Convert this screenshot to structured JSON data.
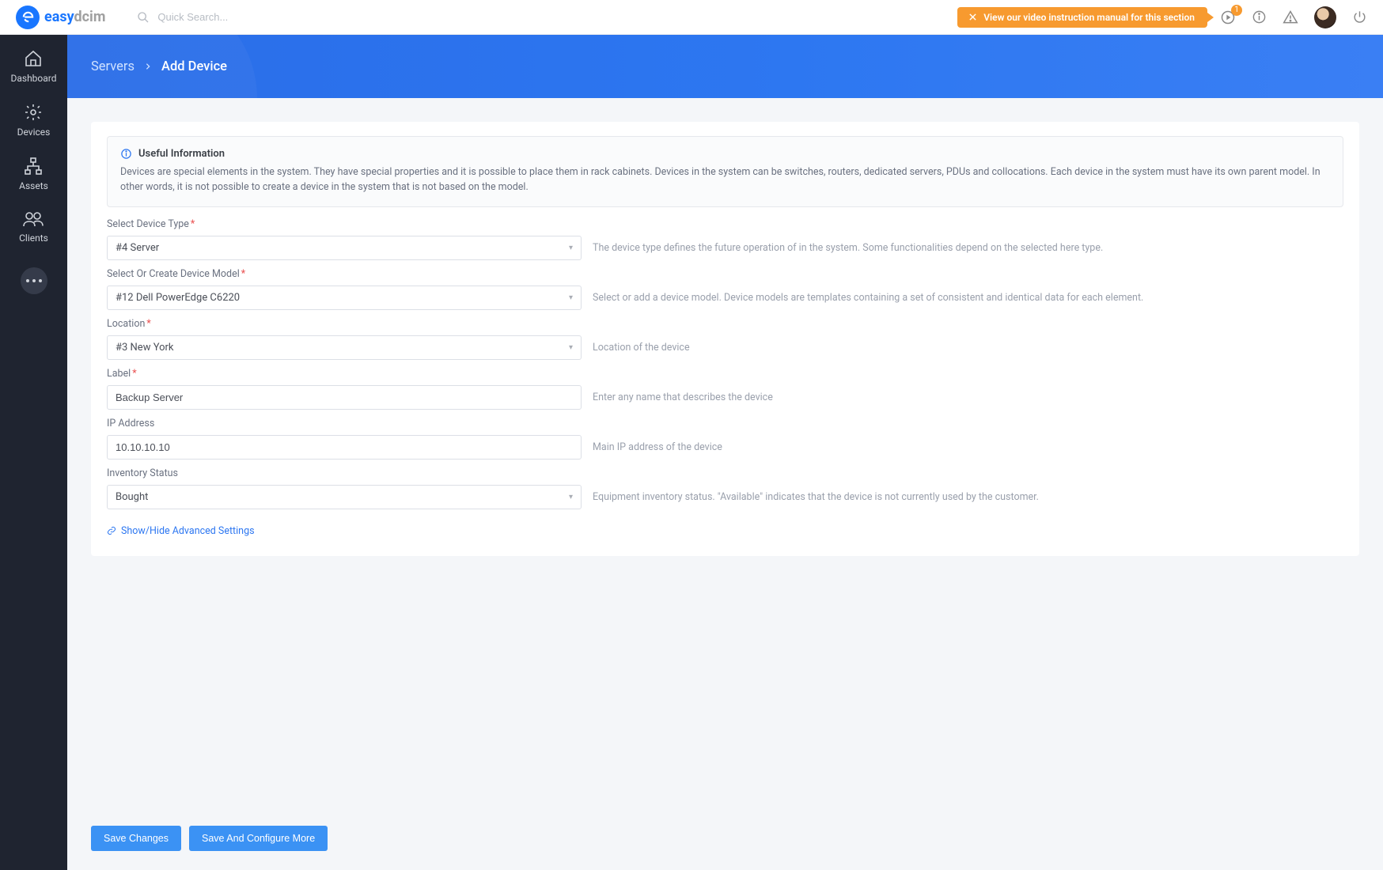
{
  "brand": {
    "easy": "easy",
    "dcim": "dcim"
  },
  "search": {
    "placeholder": "Quick Search..."
  },
  "banner": {
    "text": "View our video instruction manual for this section"
  },
  "notification_count": "1",
  "sidebar": {
    "items": [
      {
        "label": "Dashboard"
      },
      {
        "label": "Devices"
      },
      {
        "label": "Assets"
      },
      {
        "label": "Clients"
      }
    ]
  },
  "breadcrumb": {
    "root": "Servers",
    "leaf": "Add Device"
  },
  "info": {
    "title": "Useful Information",
    "body": "Devices are special elements in the system. They have special properties and it is possible to place them in rack cabinets. Devices in the system can be switches, routers, dedicated servers, PDUs and collocations. Each device in the system must have its own parent model. In other words, it is not possible to create a device in the system that is not based on the model."
  },
  "fields": {
    "type": {
      "label": "Select Device Type",
      "value": "#4 Server",
      "help": "The device type defines the future operation of in the system. Some functionalities depend on the selected here type."
    },
    "model": {
      "label": "Select Or Create Device Model",
      "value": "#12 Dell PowerEdge C6220",
      "help": "Select or add a device model. Device models are templates containing a set of consistent and identical data for each element."
    },
    "loc": {
      "label": "Location",
      "value": "#3 New York",
      "help": "Location of the device"
    },
    "labelf": {
      "label": "Label",
      "value": "Backup Server",
      "help": "Enter any name that describes the device"
    },
    "ip": {
      "label": "IP Address",
      "value": "10.10.10.10",
      "help": "Main IP address of the device"
    },
    "inv": {
      "label": "Inventory Status",
      "value": "Bought",
      "help": "Equipment inventory status. \"Available\" indicates that the device is not currently used by the customer."
    }
  },
  "adv_link": "Show/Hide Advanced Settings",
  "buttons": {
    "save": "Save Changes",
    "save_more": "Save And Configure More"
  }
}
